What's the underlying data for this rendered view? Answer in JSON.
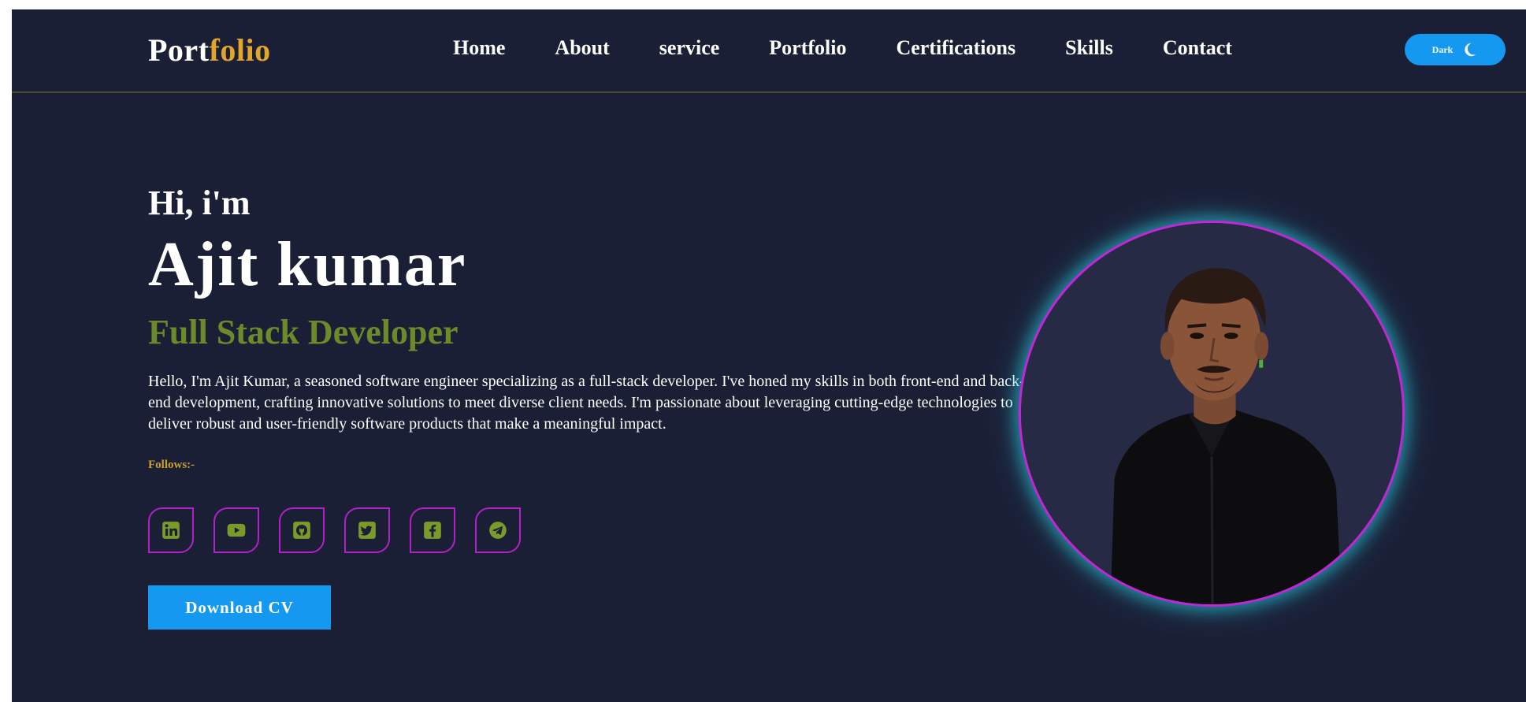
{
  "navbar": {
    "brand_main": "Port",
    "brand_accent": "folio",
    "links": [
      "Home",
      "About",
      "service",
      "Portfolio",
      "Certifications",
      "Skills",
      "Contact"
    ],
    "theme_toggle_label": "Dark",
    "theme_icon": "moon-icon"
  },
  "hero": {
    "greeting": "Hi, i'm",
    "name": "Ajit kumar",
    "role": "Full Stack Developer",
    "description": "Hello, I'm Ajit Kumar, a seasoned software engineer specializing as a full-stack developer. I've honed my skills in both front-end and back-end development, crafting innovative solutions to meet diverse client needs. I'm passionate about leveraging cutting-edge technologies to deliver robust and user-friendly software products that make a meaningful impact.",
    "follows_label": "Follows:-",
    "socials": [
      "linkedin-icon",
      "youtube-icon",
      "github-icon",
      "twitter-icon",
      "facebook-icon",
      "telegram-icon"
    ],
    "download_label": "Download CV"
  },
  "colors": {
    "background": "#1b1f36",
    "brand_accent": "#e0a52a",
    "role_green": "#6c8a2a",
    "primary_blue": "#1598f0",
    "social_border": "#b021c8",
    "photo_ring": "#c425d6",
    "photo_glow": "#28c8dc"
  }
}
